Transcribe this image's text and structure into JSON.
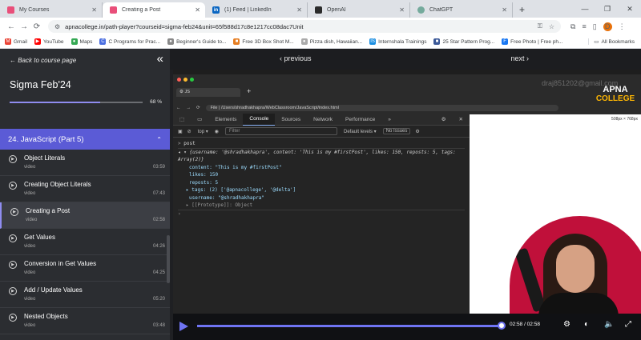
{
  "tabs": [
    {
      "title": "My Courses",
      "fav": "",
      "fav_color": "#e94f7a"
    },
    {
      "title": "Creating a Post",
      "fav": "",
      "fav_color": "#e94f7a"
    },
    {
      "title": "(1) Feed | LinkedIn",
      "fav": "in",
      "fav_color": "#0a66c2"
    },
    {
      "title": "OpenAI",
      "fav": "",
      "fav_color": "#2b2b2b"
    },
    {
      "title": "ChatGPT",
      "fav": "",
      "fav_color": "#74aa9c"
    }
  ],
  "address": {
    "url": "apnacollege.in/path-player?courseid=sigma-feb24&unit=65f588d17c8e1217cc08dac7Unit"
  },
  "profile_letter": "D",
  "bookmarks": [
    "Gmail",
    "YouTube",
    "Maps",
    "C Programs for Prac...",
    "Beginner's Guide to...",
    "Free 3D Box Shot M...",
    "Pizza dish, Hawaiian...",
    "Internshala Trainings",
    "25 Star Pattern Prog...",
    "Free Photo | Free ph..."
  ],
  "bookmarks_all": "All Bookmarks",
  "sidebar": {
    "back_label": "← Back to course page",
    "course_title": "Sigma Feb'24",
    "progress_pct": 68,
    "progress_label": "68 %",
    "section_title": "24. JavaScript (Part 5)",
    "lessons": [
      {
        "title": "Object Literals",
        "type": "video",
        "duration": "03:59"
      },
      {
        "title": "Creating Object Literals",
        "type": "video",
        "duration": "07:43"
      },
      {
        "title": "Creating a Post",
        "type": "video",
        "duration": "02:58"
      },
      {
        "title": "Get Values",
        "type": "video",
        "duration": "04:26"
      },
      {
        "title": "Conversion in Get Values",
        "type": "video",
        "duration": "04:25"
      },
      {
        "title": "Add / Update Values",
        "type": "video",
        "duration": "05:20"
      },
      {
        "title": "Nested Objects",
        "type": "video",
        "duration": "03:48"
      }
    ]
  },
  "player": {
    "prev_label": "‹ previous",
    "next_label": "next ›",
    "current_time": "02:58 / 02:58",
    "progress_pct": 100
  },
  "video": {
    "tab": "JS",
    "file_label": "File",
    "file_url": "/Users/shradhakhapra/WebClassroom/JavaScript/index.html",
    "watermark": "draj851202@gmail.com",
    "brand_top": "APNA",
    "brand_bottom": "COLLEGE",
    "page_size": "508px × 768px",
    "devtools_tabs": [
      "Elements",
      "Console",
      "Sources",
      "Network",
      "Performance",
      "»"
    ],
    "context": "top ▾",
    "filter_placeholder": "Filter",
    "levels": "Default levels ▾",
    "issues": "No Issues",
    "console_lines": {
      "input": "post",
      "summary": "{username: '@shradhakhapra', content: 'This is my #firstPost', likes: 150, reposts: 5, tags: Array(2)}",
      "content": "content: \"This is my #firstPost\"",
      "likes": "likes: 150",
      "reposts": "reposts: 5",
      "tags": "tags: (2) ['@apnacollege', '@delta']",
      "username": "username: \"@shradhakhapra\"",
      "proto": "[[Prototype]]: Object"
    }
  }
}
